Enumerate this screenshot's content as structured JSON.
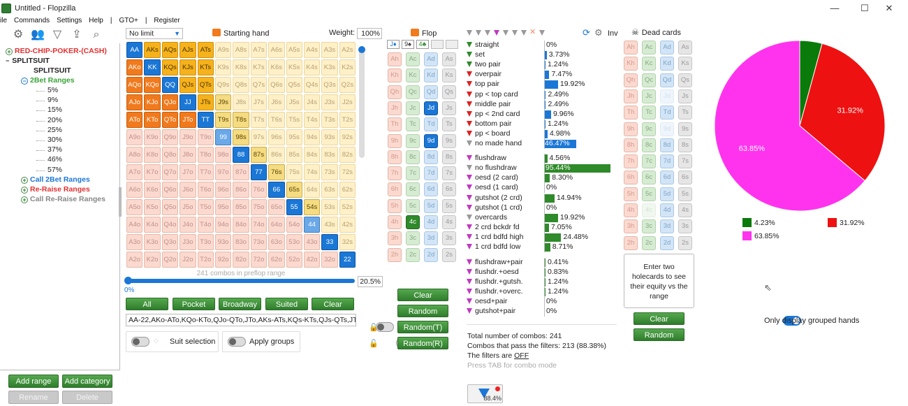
{
  "window": {
    "title": "Untitled - Flopzilla",
    "min": "—",
    "max": "☐",
    "close": "✕"
  },
  "menu": [
    "ile",
    "Commands",
    "Settings",
    "Help",
    "|",
    "GTO+",
    "|",
    "Register"
  ],
  "tree": {
    "root1": "RED-CHIP-POKER-(CASH)",
    "root2": "SPLITSUIT",
    "child": "SPLITSUIT",
    "group": "2Bet Ranges",
    "items": [
      "5%",
      "9%",
      "15%",
      "20%",
      "25%",
      "30%",
      "37%",
      "46%",
      "57%"
    ],
    "call": "Call 2Bet Ranges",
    "reraise": "Re-Raise Ranges",
    "callreraise": "Call Re-Raise Ranges"
  },
  "leftbuttons": {
    "add_range": "Add range",
    "add_category": "Add category",
    "rename": "Rename",
    "delete": "Delete"
  },
  "range": {
    "limit": "No limit",
    "starting_hand": "Starting hand",
    "weight_label": "Weight:",
    "weight": "100%",
    "combos": "241 combos in preflop range",
    "pct_left": "0%",
    "pct_right": "20.5%",
    "buttons": {
      "all": "All",
      "pocket": "Pocket",
      "broadway": "Broadway",
      "suited": "Suited",
      "clear": "Clear"
    },
    "text": "AA-22,AKo-ATo,KQo-KTo,QJo-QTo,JTo,AKs-ATs,KQs-KTs,QJs-QTs,JTs-J9s",
    "suit_selection": "Suit selection",
    "apply_groups": "Apply groups"
  },
  "grid": [
    [
      "AA",
      "AKs",
      "AQs",
      "AJs",
      "ATs",
      "A9s",
      "A8s",
      "A7s",
      "A6s",
      "A5s",
      "A4s",
      "A3s",
      "A2s"
    ],
    [
      "AKo",
      "KK",
      "KQs",
      "KJs",
      "KTs",
      "K9s",
      "K8s",
      "K7s",
      "K6s",
      "K5s",
      "K4s",
      "K3s",
      "K2s"
    ],
    [
      "AQo",
      "KQo",
      "QQ",
      "QJs",
      "QTs",
      "Q9s",
      "Q8s",
      "Q7s",
      "Q6s",
      "Q5s",
      "Q4s",
      "Q3s",
      "Q2s"
    ],
    [
      "AJo",
      "KJo",
      "QJo",
      "JJ",
      "JTs",
      "J9s",
      "J8s",
      "J7s",
      "J6s",
      "J5s",
      "J4s",
      "J3s",
      "J2s"
    ],
    [
      "ATo",
      "KTo",
      "QTo",
      "JTo",
      "TT",
      "T9s",
      "T8s",
      "T7s",
      "T6s",
      "T5s",
      "T4s",
      "T3s",
      "T2s"
    ],
    [
      "A9o",
      "K9o",
      "Q9o",
      "J9o",
      "T9o",
      "99",
      "98s",
      "97s",
      "96s",
      "95s",
      "94s",
      "93s",
      "92s"
    ],
    [
      "A8o",
      "K8o",
      "Q8o",
      "J8o",
      "T8o",
      "98o",
      "88",
      "87s",
      "86s",
      "85s",
      "84s",
      "83s",
      "82s"
    ],
    [
      "A7o",
      "K7o",
      "Q7o",
      "J7o",
      "T7o",
      "97o",
      "87o",
      "77",
      "76s",
      "75s",
      "74s",
      "73s",
      "72s"
    ],
    [
      "A6o",
      "K6o",
      "Q6o",
      "J6o",
      "T6o",
      "96o",
      "86o",
      "76o",
      "66",
      "65s",
      "64s",
      "63s",
      "62s"
    ],
    [
      "A5o",
      "K5o",
      "Q5o",
      "J5o",
      "T5o",
      "95o",
      "85o",
      "75o",
      "65o",
      "55",
      "54s",
      "53s",
      "52s"
    ],
    [
      "A4o",
      "K4o",
      "Q4o",
      "J4o",
      "T4o",
      "94o",
      "84o",
      "74o",
      "64o",
      "54o",
      "44",
      "43s",
      "42s"
    ],
    [
      "A3o",
      "K3o",
      "Q3o",
      "J3o",
      "T3o",
      "93o",
      "83o",
      "73o",
      "63o",
      "53o",
      "43o",
      "33",
      "32s"
    ],
    [
      "A2o",
      "K2o",
      "Q2o",
      "J2o",
      "T2o",
      "92o",
      "82o",
      "72o",
      "62o",
      "52o",
      "42o",
      "32o",
      "22"
    ]
  ],
  "flop": {
    "label": "Flop",
    "board": [
      "J♦",
      "9♠",
      "4♣"
    ],
    "clear": "Clear",
    "random": "Random",
    "random_t": "Random(T)",
    "random_r": "Random(R)"
  },
  "ranks": [
    "A",
    "K",
    "Q",
    "J",
    "T",
    "9",
    "8",
    "7",
    "6",
    "5",
    "4",
    "3",
    "2"
  ],
  "stats": {
    "inv": "Inv",
    "made": [
      {
        "label": "straight",
        "icon": "green",
        "val": "0%",
        "pct": 0
      },
      {
        "label": "set",
        "icon": "green",
        "val": "3.73%",
        "pct": 3.73
      },
      {
        "label": "two pair",
        "icon": "green",
        "val": "1.24%",
        "pct": 1.24
      },
      {
        "label": "overpair",
        "icon": "red",
        "val": "7.47%",
        "pct": 7.47
      },
      {
        "label": "top pair",
        "icon": "red",
        "val": "19.92%",
        "pct": 19.92
      },
      {
        "label": "pp < top card",
        "icon": "red",
        "val": "2.49%",
        "pct": 2.49
      },
      {
        "label": "middle pair",
        "icon": "red",
        "val": "2.49%",
        "pct": 2.49
      },
      {
        "label": "pp < 2nd card",
        "icon": "red",
        "val": "9.96%",
        "pct": 9.96
      },
      {
        "label": "bottom pair",
        "icon": "red",
        "val": "1.24%",
        "pct": 1.24
      },
      {
        "label": "pp < board",
        "icon": "red",
        "val": "4.98%",
        "pct": 4.98
      },
      {
        "label": "no made hand",
        "icon": "gray",
        "val": "46.47%",
        "pct": 46.47
      }
    ],
    "draws": [
      {
        "label": "flushdraw",
        "icon": "magenta",
        "val": "4.56%",
        "pct": 4.56
      },
      {
        "label": "no flushdraw",
        "icon": "gray",
        "val": "95.44%",
        "pct": 95.44
      },
      {
        "label": "oesd (2 card)",
        "icon": "magenta",
        "val": "8.30%",
        "pct": 8.3
      },
      {
        "label": "oesd (1 card)",
        "icon": "magenta",
        "val": "0%",
        "pct": 0
      },
      {
        "label": "gutshot (2 crd)",
        "icon": "magenta",
        "val": "14.94%",
        "pct": 14.94
      },
      {
        "label": "gutshot (1 crd)",
        "icon": "magenta",
        "val": "0%",
        "pct": 0
      },
      {
        "label": "overcards",
        "icon": "gray",
        "val": "19.92%",
        "pct": 19.92
      },
      {
        "label": "2 crd bckdr fd",
        "icon": "magenta",
        "val": "7.05%",
        "pct": 7.05
      },
      {
        "label": "1 crd bdfd high",
        "icon": "magenta",
        "val": "24.48%",
        "pct": 24.48
      },
      {
        "label": "1 crd bdfd low",
        "icon": "magenta",
        "val": "8.71%",
        "pct": 8.71
      }
    ],
    "combo": [
      {
        "label": "flushdraw+pair",
        "icon": "magenta",
        "val": "0.41%",
        "pct": 0.41
      },
      {
        "label": "flushdr.+oesd",
        "icon": "magenta",
        "val": "0.83%",
        "pct": 0.83
      },
      {
        "label": "flushdr.+gutsh.",
        "icon": "magenta",
        "val": "1.24%",
        "pct": 1.24
      },
      {
        "label": "flushdr.+overc.",
        "icon": "magenta",
        "val": "1.24%",
        "pct": 1.24
      },
      {
        "label": "oesd+pair",
        "icon": "magenta",
        "val": "0%",
        "pct": 0
      },
      {
        "label": "gutshot+pair",
        "icon": "magenta",
        "val": "0%",
        "pct": 0
      }
    ],
    "total": "Total number of combos: 241",
    "pass": "Combos that pass the filters: 213 (88.38%)",
    "filters_prefix": "The filters are ",
    "filters_state": "OFF",
    "tab_hint": "Press TAB for combo mode",
    "filter_pct": "88.4%"
  },
  "dead": {
    "label": "Dead cards",
    "equity_hint": "Enter two holecards to see their equity vs the range",
    "clear": "Clear",
    "random": "Random"
  },
  "chart_data": {
    "type": "pie",
    "slices": [
      {
        "label": "4.23%",
        "value": 4.23,
        "color": "#0a7a0a"
      },
      {
        "label": "31.92%",
        "value": 31.92,
        "color": "#ee1111"
      },
      {
        "label": "63.85%",
        "value": 63.85,
        "color": "#ff33ee"
      }
    ],
    "grouped_label": "Only display grouped hands"
  },
  "colors": {
    "green": "#2f8a2a",
    "red": "#dd2222",
    "magenta": "#c03ac0",
    "gray": "#999999",
    "blue": "#1b77d6",
    "darkgreen": "#1d7a1a"
  }
}
